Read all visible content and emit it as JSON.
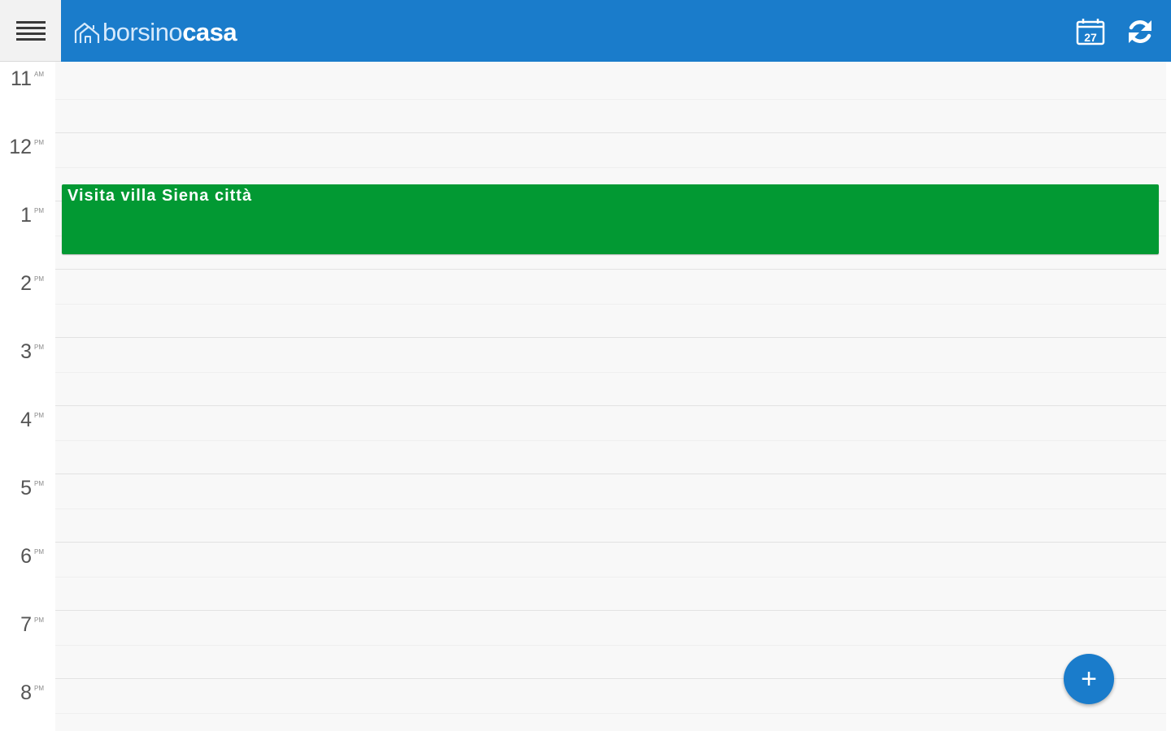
{
  "app": {
    "logo_light": "borsino",
    "logo_bold": "casa"
  },
  "header": {
    "calendar_icon": "calendar-icon",
    "calendar_day": "27",
    "refresh_icon": "refresh-icon",
    "menu_icon": "hamburger-icon"
  },
  "calendar": {
    "hours": [
      {
        "num": "11",
        "ampm": "AM"
      },
      {
        "num": "12",
        "ampm": "PM"
      },
      {
        "num": "1",
        "ampm": "PM"
      },
      {
        "num": "2",
        "ampm": "PM"
      },
      {
        "num": "3",
        "ampm": "PM"
      },
      {
        "num": "4",
        "ampm": "PM"
      },
      {
        "num": "5",
        "ampm": "PM"
      },
      {
        "num": "6",
        "ampm": "PM"
      },
      {
        "num": "7",
        "ampm": "PM"
      },
      {
        "num": "8",
        "ampm": "PM"
      }
    ],
    "events": [
      {
        "title": "Visita villa Siena città",
        "color": "#029933"
      }
    ]
  },
  "fab": {
    "label": "+",
    "icon": "add-icon"
  },
  "colors": {
    "accent": "#1a7ccb",
    "event": "#029933"
  }
}
